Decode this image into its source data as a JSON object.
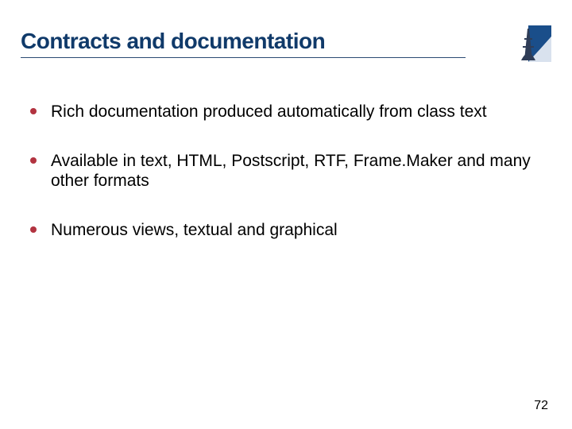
{
  "title": "Contracts and documentation",
  "bullets": [
    "Rich documentation produced automatically from class text",
    "Available in text, HTML, Postscript, RTF, Frame.Maker and many other formats",
    "Numerous views, textual and graphical"
  ],
  "page_number": "72",
  "colors": {
    "title": "#103a6a",
    "bullet": "#b23340",
    "rule": "#2b4b73"
  },
  "logo_alt": "eiffel-tower-logo"
}
